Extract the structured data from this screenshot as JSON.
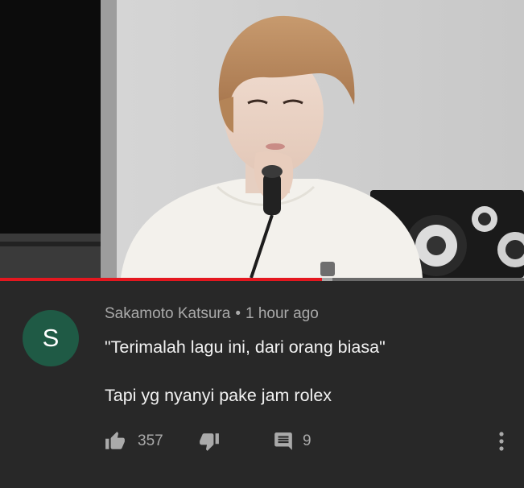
{
  "video": {
    "progress_fraction": 0.615,
    "buffer_fraction": 0.02
  },
  "comment": {
    "avatar_letter": "S",
    "avatar_color": "#1f5a45",
    "author": "Sakamoto Katsura",
    "separator": "•",
    "time": "1 hour ago",
    "line1": "\"Terimalah lagu ini, dari orang biasa\"",
    "line2": "Tapi yg nyanyi pake jam rolex",
    "likes": "357",
    "replies": "9"
  },
  "icons": {
    "like": "thumbs-up-icon",
    "dislike": "thumbs-down-icon",
    "reply": "comment-icon",
    "more": "more-vertical-icon"
  },
  "colors": {
    "background": "#282828",
    "progress": "#e4171f",
    "meta_text": "#aaaaaa"
  }
}
